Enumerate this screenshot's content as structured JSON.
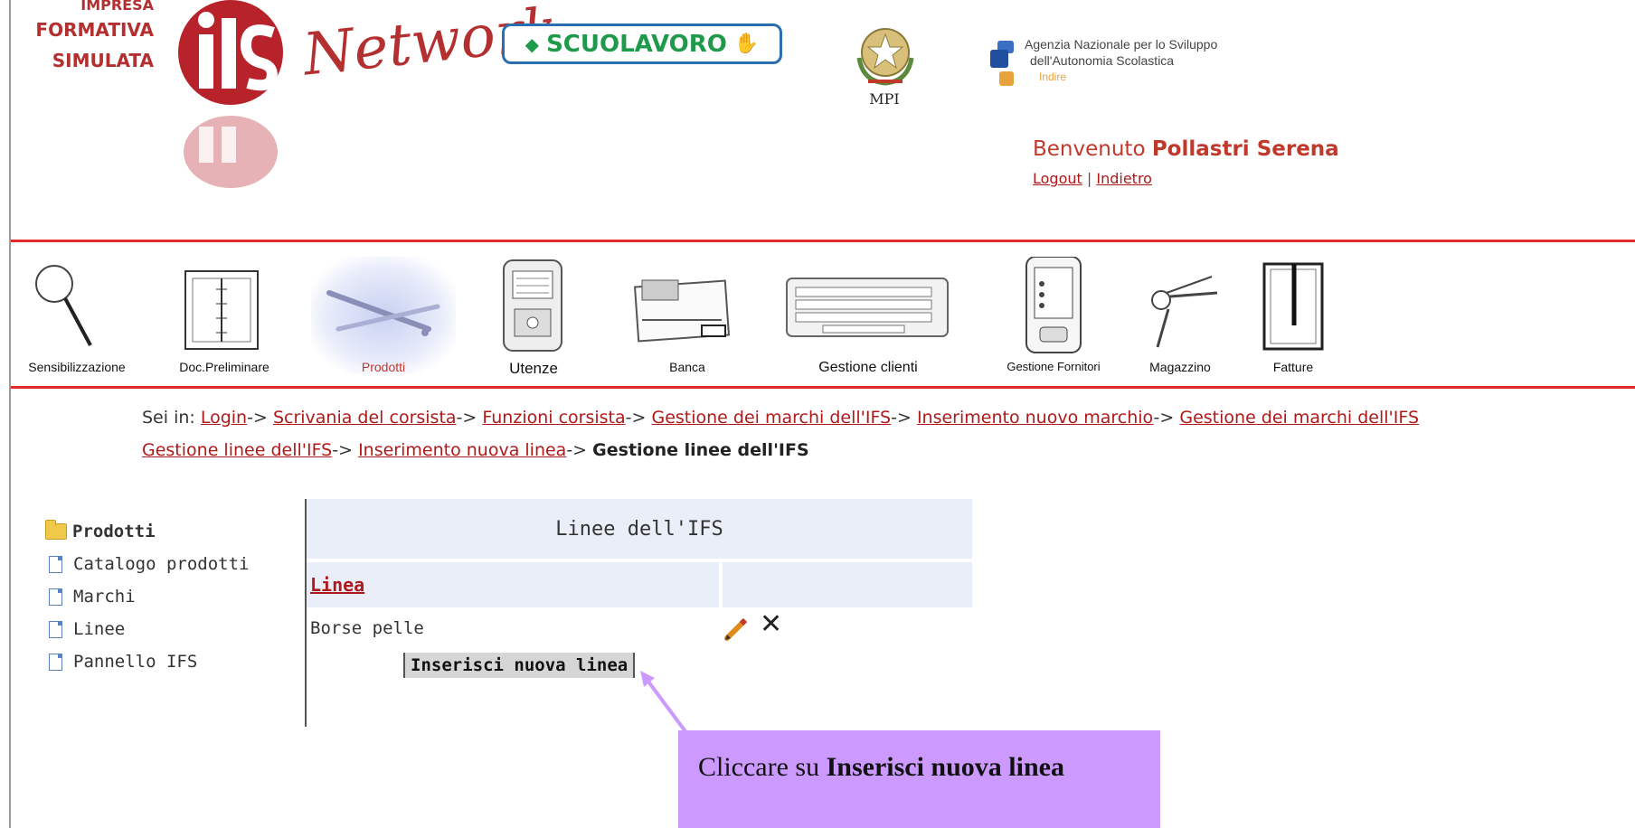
{
  "header": {
    "brand_lines": [
      "IMPRESA",
      "FORMATIVA",
      "SIMULATA"
    ],
    "network_text": "Network",
    "scuolavoro": "SCUOLAVORO",
    "mpi": "MPI",
    "agenzia_line1": "Agenzia Nazionale per lo Sviluppo",
    "agenzia_line2": "dell'Autonomia Scolastica",
    "agenzia_line3": "Indire",
    "welcome_prefix": "Benvenuto",
    "welcome_name": "Pollastri Serena",
    "logout": "Logout",
    "separator": "|",
    "back": "Indietro"
  },
  "nav": {
    "items": [
      {
        "label": "Sensibilizzazione",
        "icon": "magnifier-icon"
      },
      {
        "label": "Doc.Preliminare",
        "icon": "binder-icon"
      },
      {
        "label": "Prodotti",
        "icon": "pens-icon",
        "selected": true
      },
      {
        "label": "Utenze",
        "icon": "meter-icon"
      },
      {
        "label": "Banca",
        "icon": "card-icon"
      },
      {
        "label": "Gestione clienti",
        "icon": "keyboard-icon"
      },
      {
        "label": "Gestione Fornitori",
        "icon": "pda-icon"
      },
      {
        "label": "Magazzino",
        "icon": "keys-icon"
      },
      {
        "label": "Fatture",
        "icon": "document-icon"
      }
    ]
  },
  "breadcrumb": {
    "prefix": "Sei in:",
    "items": [
      "Login",
      "Scrivania del corsista",
      "Funzioni corsista",
      "Gestione dei marchi dell'IFS",
      "Inserimento nuovo marchio",
      "Gestione dei marchi dell'IFS",
      "Gestione linee dell'IFS",
      "Inserimento nuova linea"
    ],
    "arrow": "->",
    "current": "Gestione linee dell'IFS"
  },
  "sidebar": {
    "title": "Prodotti",
    "items": [
      "Catalogo prodotti",
      "Marchi",
      "Linee",
      "Pannello IFS"
    ]
  },
  "table": {
    "title": "Linee dell'IFS",
    "column": "Linea",
    "rows": [
      "Borse pelle"
    ],
    "insert_button": "Inserisci nuova linea"
  },
  "callout": {
    "text_before": "Cliccare su",
    "text_bold": "Inserisci nuova linea",
    "color": "#cc99ff"
  }
}
